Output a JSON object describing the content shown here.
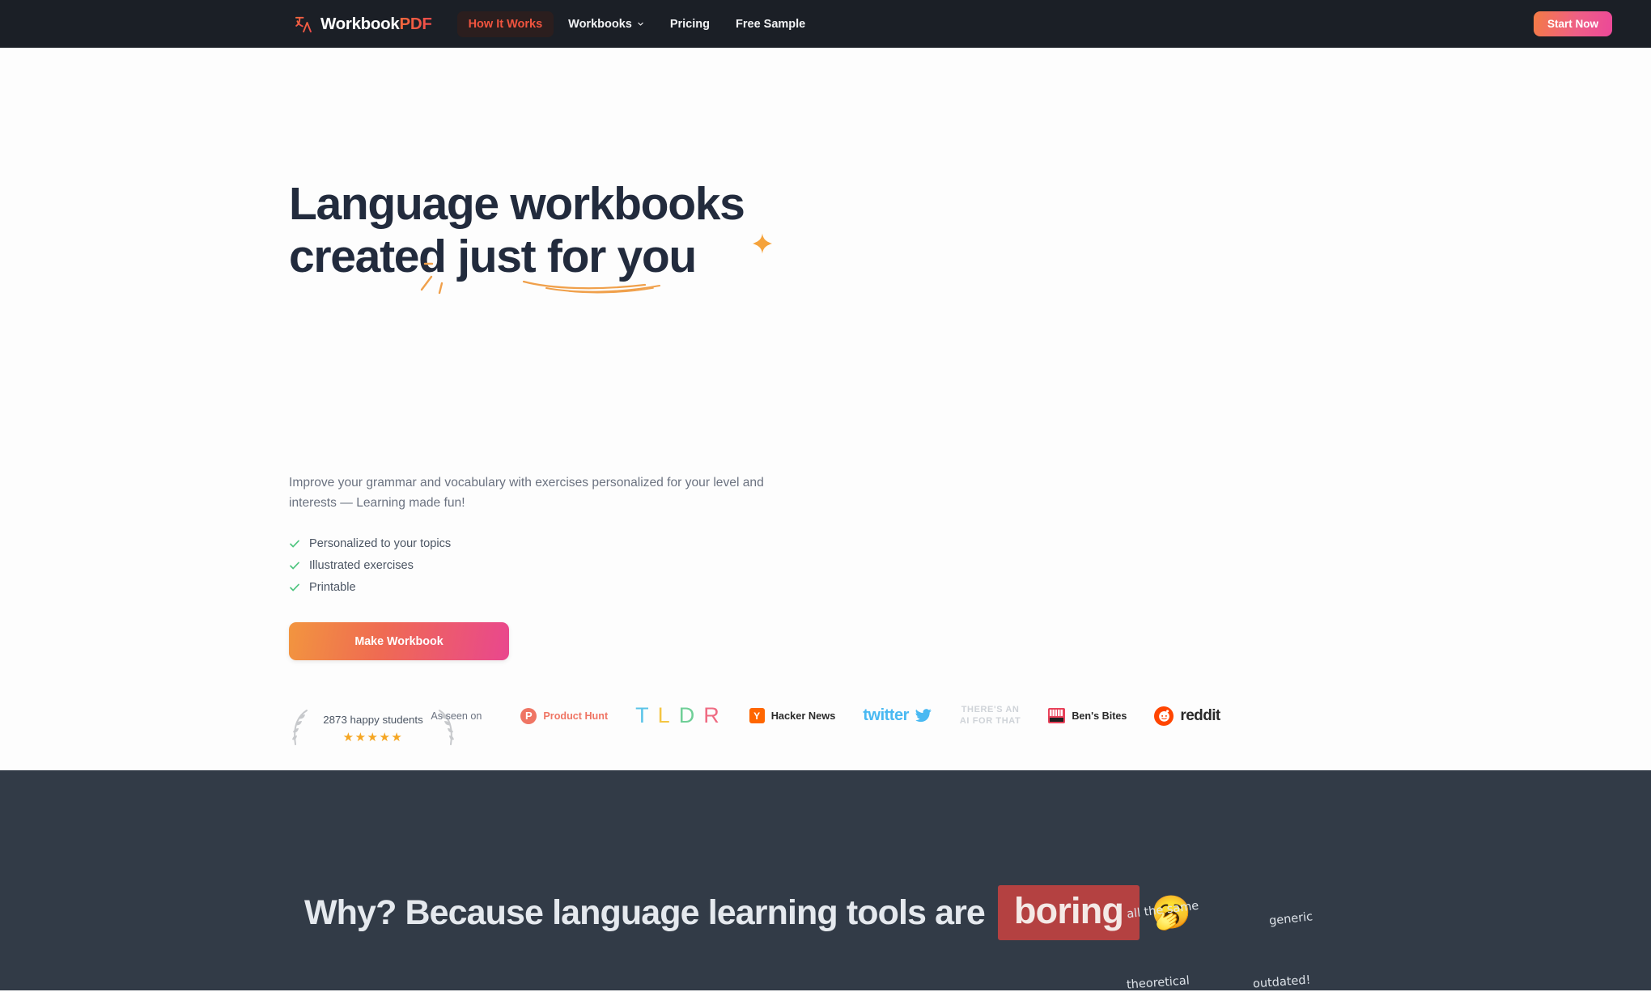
{
  "nav": {
    "logo": {
      "icon": "translate-icon",
      "text_primary": "Workbook",
      "text_accent": "PDF"
    },
    "links": [
      {
        "label": "How It Works",
        "active": true
      },
      {
        "label": "Workbooks",
        "active": false,
        "has_chevron": true
      },
      {
        "label": "Pricing",
        "active": false
      },
      {
        "label": "Free Sample",
        "active": false
      }
    ],
    "cta": {
      "label": "Start Now"
    },
    "background": "#1b1f26",
    "accent": "#f0543f"
  },
  "hero": {
    "title": "Language workbooks\ncreated just for you",
    "title_color": "#222b3d",
    "sparkle_icon": "sparkle-icon",
    "subtitle": "Improve your grammar and vocabulary with exercises personalized for your level and interests — Learning made fun!",
    "features": [
      {
        "icon": "check-icon",
        "label": "Personalized to your topics"
      },
      {
        "icon": "check-icon",
        "label": "Illustrated exercises"
      },
      {
        "icon": "check-icon",
        "label": "Printable"
      }
    ],
    "cta": {
      "label": "Make Workbook",
      "gradient_from": "#f2953f",
      "gradient_to": "#e9478e"
    },
    "rating": {
      "count_text": "2873 happy students",
      "stars": "★★★★★",
      "star_color": "#f5a623"
    }
  },
  "press": {
    "label": "As seen on",
    "brands": [
      {
        "name": "Product Hunt",
        "mark": "P",
        "color": "#ef7564"
      },
      {
        "name": "TLDR",
        "letters": [
          "T",
          "L",
          "D",
          "R"
        ]
      },
      {
        "name": "Hacker News",
        "mark": "Y",
        "color": "#ff6600"
      },
      {
        "name": "twitter",
        "color": "#49b9f2"
      },
      {
        "name": "THERE'S AN AI FOR THAT",
        "line1": "THERE'S AN",
        "line2": "AI FOR THAT"
      },
      {
        "name": "Ben's Bites",
        "color": "#e8425a"
      },
      {
        "name": "reddit",
        "color": "#ff4500"
      }
    ]
  },
  "why_section": {
    "background": "#323b47",
    "heading": "Why? Because language learning tools are",
    "highlight": "boring",
    "highlight_bg": "#b44141",
    "emoji": "🥱",
    "annotations": [
      {
        "text": "all the same"
      },
      {
        "text": "generic"
      },
      {
        "text": "theoretical"
      },
      {
        "text": "outdated!"
      }
    ]
  }
}
